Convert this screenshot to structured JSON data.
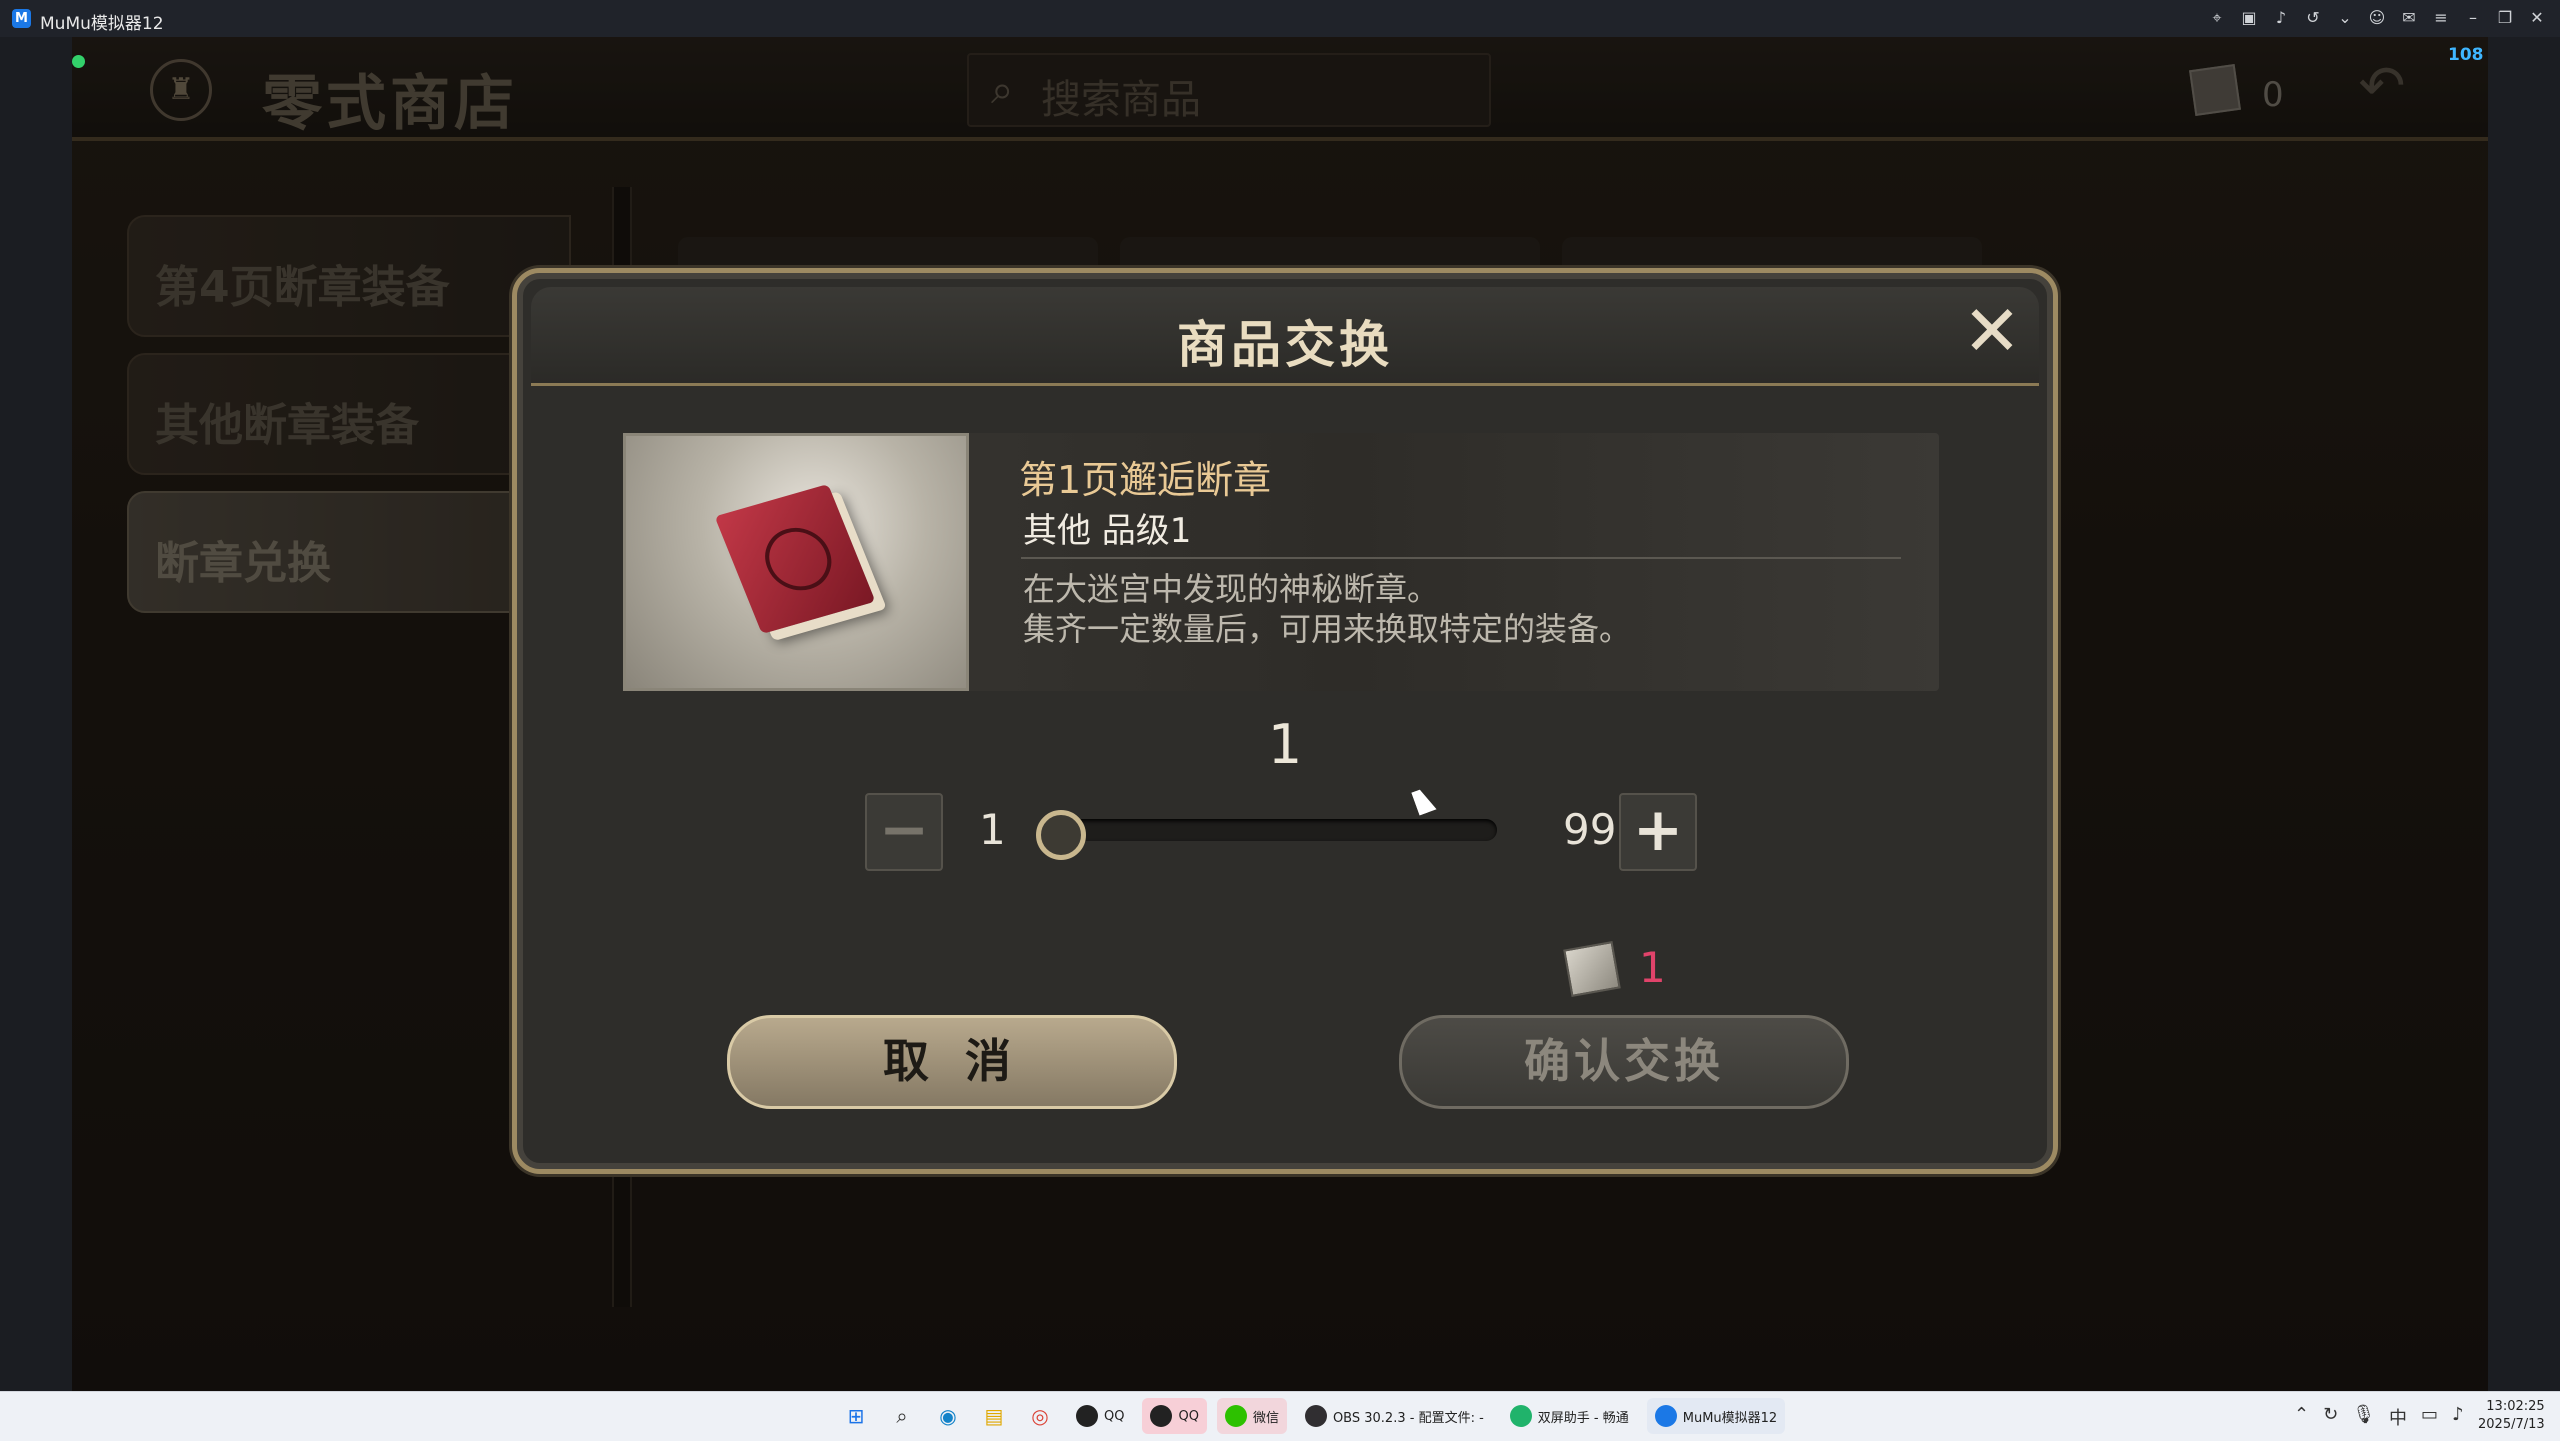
{
  "window": {
    "title": "MuMu模拟器12",
    "fps": "108"
  },
  "shop": {
    "title": "零式商店",
    "search_placeholder": "搜索商品",
    "currency_count": "0",
    "categories": [
      {
        "label": "第4页断章装备"
      },
      {
        "label": "其他断章装备"
      },
      {
        "label": "断章兑换"
      }
    ]
  },
  "dialog": {
    "title": "商品交换",
    "item": {
      "name": "第1页邂逅断章",
      "type": "其他 品级1",
      "description": "在大迷宫中发现的神秘断章。\n集齐一定数量后，可用来换取特定的装备。"
    },
    "quantity": {
      "current": "1",
      "min": "1",
      "max": "99",
      "slider_fraction": 0.0
    },
    "cost": "1",
    "cancel_label": "取 消",
    "confirm_label": "确认交换"
  },
  "taskbar": {
    "apps": [
      {
        "label": "QQ"
      },
      {
        "label": "QQ"
      },
      {
        "label": "微信"
      },
      {
        "label": "OBS 30.2.3 - 配置文件: -"
      },
      {
        "label": "双屏助手 - 畅通"
      },
      {
        "label": "MuMu模拟器12"
      }
    ],
    "time": "13:02:25",
    "date": "2025/7/13"
  },
  "colors": {
    "accent_gold": "#9d8a62",
    "cost_red": "#e0436a",
    "status_green": "#33d16b"
  }
}
